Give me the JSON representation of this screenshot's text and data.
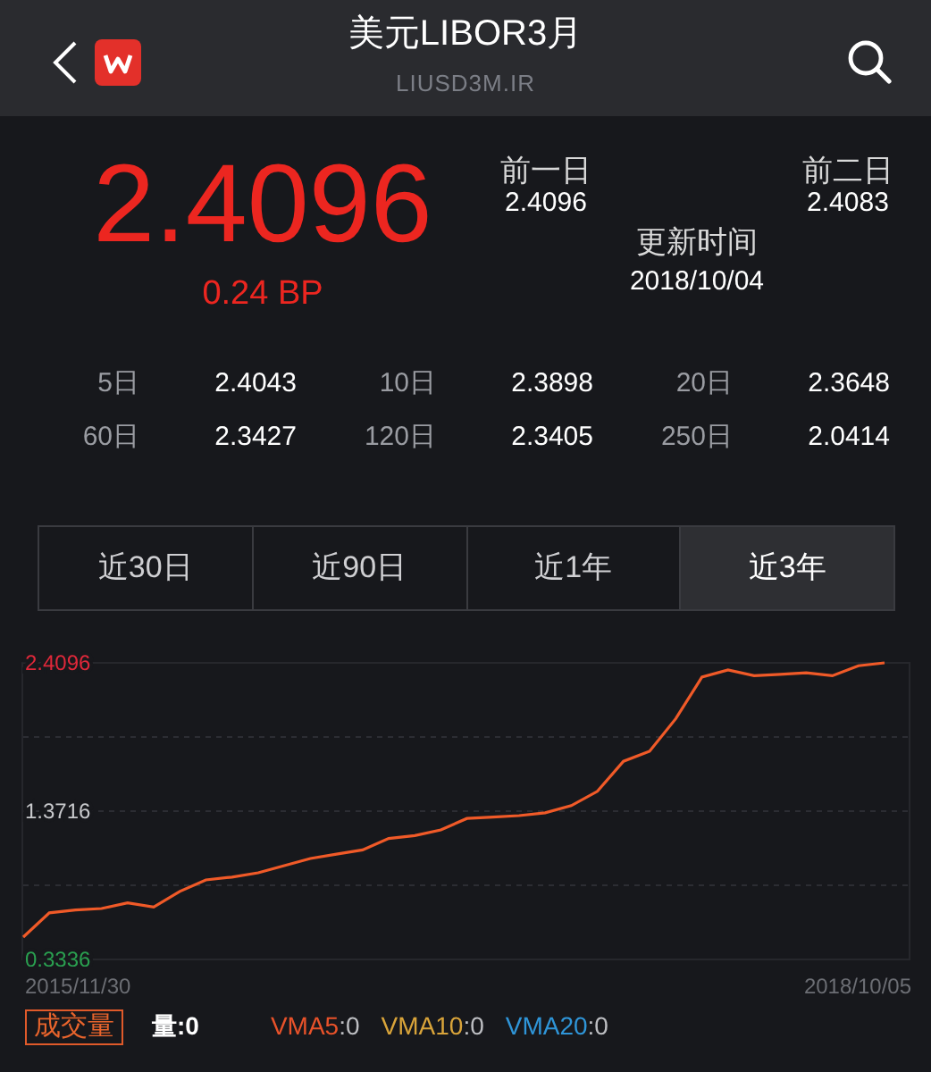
{
  "header": {
    "title": "美元LIBOR3月",
    "subtitle": "LIUSD3M.IR"
  },
  "quote": {
    "price": "2.4096",
    "change": "0.24 BP",
    "prev1_label": "前一日",
    "prev1_value": "2.4096",
    "prev2_label": "前二日",
    "prev2_value": "2.4083",
    "update_label": "更新时间",
    "update_value": "2018/10/04"
  },
  "averages": [
    {
      "label": "5日",
      "value": "2.4043"
    },
    {
      "label": "10日",
      "value": "2.3898"
    },
    {
      "label": "20日",
      "value": "2.3648"
    },
    {
      "label": "60日",
      "value": "2.3427"
    },
    {
      "label": "120日",
      "value": "2.3405"
    },
    {
      "label": "250日",
      "value": "2.0414"
    }
  ],
  "tabs": [
    {
      "label": "近30日",
      "selected": false
    },
    {
      "label": "近90日",
      "selected": false
    },
    {
      "label": "近1年",
      "selected": false
    },
    {
      "label": "近3年",
      "selected": true
    }
  ],
  "chart": {
    "start_date": "2015/11/30",
    "end_date": "2018/10/05",
    "chart_data": {
      "type": "line",
      "ylim": [
        0.3336,
        2.4096
      ],
      "yticks": [
        {
          "value": 2.4096,
          "label": "2.4096"
        },
        {
          "value": 1.3716,
          "label": "1.3716"
        },
        {
          "value": 0.3336,
          "label": "0.3336"
        }
      ],
      "series": [
        {
          "color": "#f05a28",
          "values": [
            0.49,
            0.66,
            0.68,
            0.69,
            0.73,
            0.7,
            0.81,
            0.89,
            0.91,
            0.94,
            0.99,
            1.04,
            1.07,
            1.1,
            1.18,
            1.2,
            1.24,
            1.32,
            1.33,
            1.34,
            1.36,
            1.41,
            1.51,
            1.72,
            1.79,
            2.02,
            2.31,
            2.36,
            2.32,
            2.33,
            2.34,
            2.32,
            2.39,
            2.4096
          ]
        }
      ]
    }
  },
  "volume": {
    "tab": "成交量",
    "amount": "量:0",
    "indicators": [
      {
        "name": "VMA5",
        "value": ":0",
        "color": "#e8522a"
      },
      {
        "name": "VMA10",
        "value": ":0",
        "color": "#d9a43a"
      },
      {
        "name": "VMA20",
        "value": ":0",
        "color": "#2f95d8"
      }
    ]
  }
}
